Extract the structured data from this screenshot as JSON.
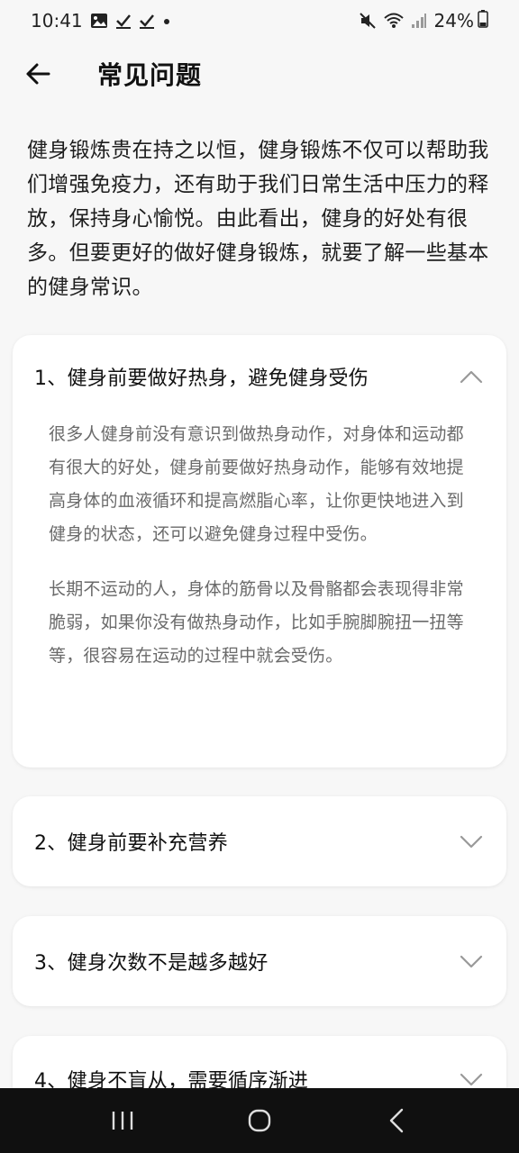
{
  "status_bar": {
    "time": "10:41",
    "battery": "24%",
    "left_icons": [
      "image-icon",
      "check-icon",
      "check-icon",
      "dot-icon"
    ],
    "right_icons": [
      "mute-icon",
      "wifi-icon",
      "signal-icon",
      "battery-icon"
    ]
  },
  "header": {
    "title": "常见问题",
    "back_icon": "arrow-left-icon"
  },
  "intro": {
    "text": "健身锻炼贵在持之以恒，健身锻炼不仅可以帮助我们增强免疫力，还有助于我们日常生活中压力的释放，保持身心愉悦。由此看出，健身的好处有很多。但要更好的做好健身锻炼，就要了解一些基本的健身常识。"
  },
  "faq": [
    {
      "title": "1、健身前要做好热身，避免健身受伤",
      "expanded": true,
      "paragraphs": [
        "很多人健身前没有意识到做热身动作，对身体和运动都有很大的好处，健身前要做好热身动作，能够有效地提高身体的血液循环和提高燃脂心率，让你更快地进入到健身的状态，还可以避免健身过程中受伤。",
        "长期不运动的人，身体的筋骨以及骨骼都会表现得非常脆弱，如果你没有做热身动作，比如手腕脚腕扭一扭等等，很容易在运动的过程中就会受伤。"
      ]
    },
    {
      "title": "2、健身前要补充营养",
      "expanded": false
    },
    {
      "title": "3、健身次数不是越多越好",
      "expanded": false
    },
    {
      "title": "4、健身不盲从，需要循序渐进",
      "expanded": false
    }
  ],
  "nav_bar": {
    "icons": [
      "recents-icon",
      "home-icon",
      "back-icon"
    ]
  }
}
